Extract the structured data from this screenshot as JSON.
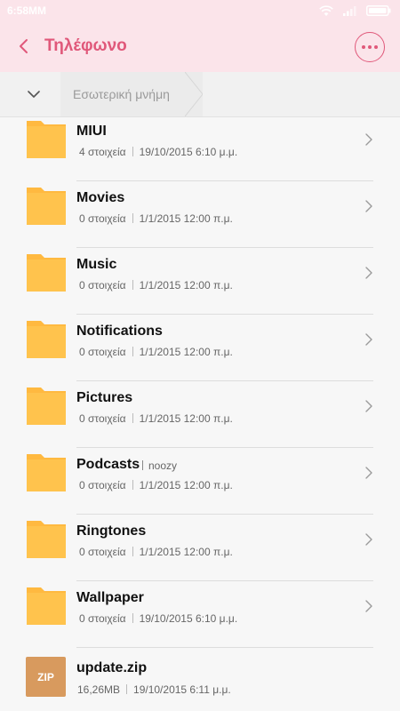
{
  "status_bar": {
    "time": "6:58MM"
  },
  "header": {
    "title": "Τηλέφωνο"
  },
  "breadcrumb": {
    "segment": "Εσωτερική μνήμη"
  },
  "files": [
    {
      "name": "MIUI",
      "count": "4 στοιχεία",
      "date": "19/10/2015 6:10 μ.μ.",
      "type": "folder"
    },
    {
      "name": "Movies",
      "count": "0 στοιχεία",
      "date": "1/1/2015 12:00 π.μ.",
      "type": "folder"
    },
    {
      "name": "Music",
      "count": "0 στοιχεία",
      "date": "1/1/2015 12:00 π.μ.",
      "type": "folder"
    },
    {
      "name": "Notifications",
      "count": "0 στοιχεία",
      "date": "1/1/2015 12:00 π.μ.",
      "type": "folder"
    },
    {
      "name": "Pictures",
      "count": "0 στοιχεία",
      "date": "1/1/2015 12:00 π.μ.",
      "type": "folder"
    },
    {
      "name": "Podcasts",
      "tag": "noozy",
      "count": "0 στοιχεία",
      "date": "1/1/2015 12:00 π.μ.",
      "type": "folder"
    },
    {
      "name": "Ringtones",
      "count": "0 στοιχεία",
      "date": "1/1/2015 12:00 π.μ.",
      "type": "folder"
    },
    {
      "name": "Wallpaper",
      "count": "0 στοιχεία",
      "date": "19/10/2015 6:10 μ.μ.",
      "type": "folder"
    },
    {
      "name": "update.zip",
      "badge": "ZIP",
      "count": "16,26MB",
      "date": "19/10/2015 6:11 μ.μ.",
      "type": "zip"
    }
  ],
  "colors": {
    "accent": "#e0587a",
    "header_bg": "#fbe4ea",
    "folder": "#ffc34d",
    "zip": "#d89a5e"
  }
}
